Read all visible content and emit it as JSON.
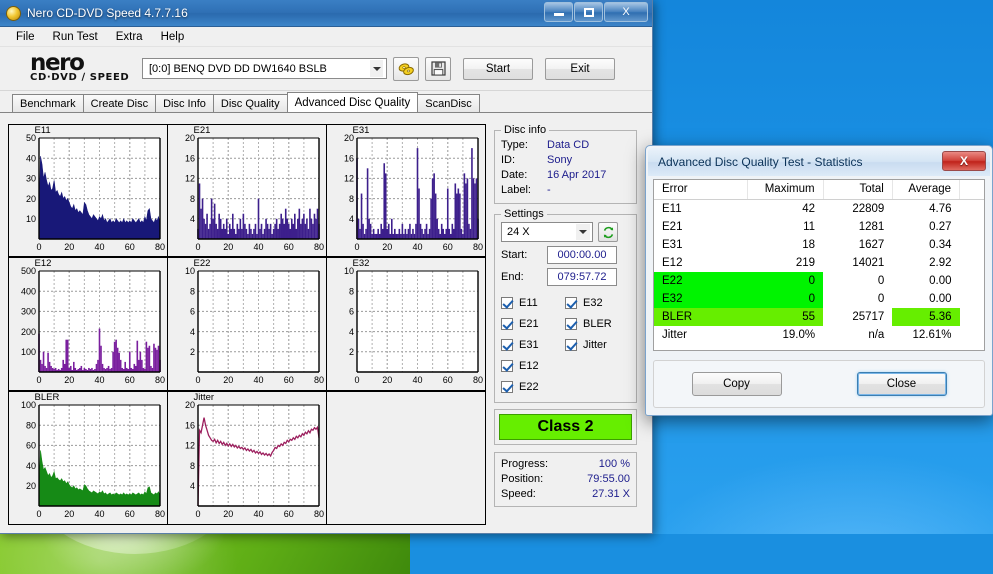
{
  "window": {
    "title": "Nero CD-DVD Speed 4.7.7.16",
    "icon": "nero-disc-icon",
    "buttons": {
      "minimize": "minimize-icon",
      "maximize": "maximize-icon",
      "close": "X"
    }
  },
  "menu": {
    "items": [
      "File",
      "Run Test",
      "Extra",
      "Help"
    ]
  },
  "toolbar": {
    "logo_main": "nero",
    "logo_sub": "CD·DVD ∕ SPEED",
    "drive": "[0:0]   BENQ DVD DD DW1640 BSLB",
    "eject_icon": "eject-disc-icon",
    "save_icon": "floppy-save-icon",
    "start_label": "Start",
    "exit_label": "Exit"
  },
  "tabs": [
    {
      "label": "Benchmark",
      "active": false
    },
    {
      "label": "Create Disc",
      "active": false
    },
    {
      "label": "Disc Info",
      "active": false
    },
    {
      "label": "Disc Quality",
      "active": false
    },
    {
      "label": "Advanced Disc Quality",
      "active": true
    },
    {
      "label": "ScanDisc",
      "active": false
    }
  ],
  "disc_info": {
    "legend": "Disc info",
    "rows": [
      {
        "key": "Type:",
        "value": "Data CD"
      },
      {
        "key": "ID:",
        "value": "Sony"
      },
      {
        "key": "Date:",
        "value": "16 Apr 2017"
      },
      {
        "key": "Label:",
        "value": "-"
      }
    ]
  },
  "settings": {
    "legend": "Settings",
    "speed": "24 X",
    "refresh_icon": "refresh-icon",
    "start_label": "Start:",
    "start_value": "000:00.00",
    "end_label": "End:",
    "end_value": "079:57.72",
    "checkboxes_left": [
      "E11",
      "E21",
      "E31",
      "E12",
      "E22"
    ],
    "checkboxes_right": [
      "E32",
      "BLER",
      "Jitter"
    ]
  },
  "class_result": "Class 2",
  "status": {
    "rows": [
      {
        "key": "Progress:",
        "value": "100 %"
      },
      {
        "key": "Position:",
        "value": "79:55.00"
      },
      {
        "key": "Speed:",
        "value": "27.31 X"
      }
    ]
  },
  "dialog": {
    "title": "Advanced Disc Quality Test - Statistics",
    "close_glyph": "X",
    "columns": [
      "Error",
      "Maximum",
      "Total",
      "Average"
    ],
    "rows": [
      {
        "error": "E11",
        "maximum": "42",
        "total": "22809",
        "average": "4.76",
        "highlight": "none"
      },
      {
        "error": "E21",
        "maximum": "11",
        "total": "1281",
        "average": "0.27",
        "highlight": "none"
      },
      {
        "error": "E31",
        "maximum": "18",
        "total": "1627",
        "average": "0.34",
        "highlight": "none"
      },
      {
        "error": "E12",
        "maximum": "219",
        "total": "14021",
        "average": "2.92",
        "highlight": "none"
      },
      {
        "error": "E22",
        "maximum": "0",
        "total": "0",
        "average": "0.00",
        "highlight": "green-bright"
      },
      {
        "error": "E32",
        "maximum": "0",
        "total": "0",
        "average": "0.00",
        "highlight": "green-bright"
      },
      {
        "error": "BLER",
        "maximum": "55",
        "total": "25717",
        "average": "5.36",
        "highlight": "green-lime-plus-avg"
      },
      {
        "error": "Jitter",
        "maximum": "19.0%",
        "total": "n/a",
        "average": "12.61%",
        "highlight": "none"
      }
    ],
    "copy_label": "Copy",
    "close_label": "Close"
  },
  "colors": {
    "titlebar_blue": "#2f70b5",
    "value_blue": "#1c1c8c",
    "green_bright": "#00f400",
    "green_lime": "#66ee00",
    "e11_navy": "#181878",
    "e12_purple": "#7a1f9e",
    "bler_green": "#168a16",
    "jitter_magenta": "#9c1f5e"
  },
  "chart_data": [
    {
      "type": "area",
      "name": "E11",
      "title": "E11",
      "xlabel": "",
      "ylabel": "",
      "xlim": [
        0,
        80
      ],
      "ylim": [
        0,
        50
      ],
      "xticks": [
        0,
        20,
        40,
        60,
        80
      ],
      "yticks": [
        10,
        20,
        30,
        40,
        50
      ],
      "grid": true,
      "color": "#181878",
      "x": [
        0,
        1,
        2,
        3,
        4,
        5,
        6,
        7,
        8,
        9,
        10,
        11,
        12,
        13,
        14,
        15,
        16,
        17,
        18,
        19,
        20,
        21,
        22,
        23,
        24,
        25,
        26,
        27,
        28,
        29,
        30,
        31,
        32,
        33,
        34,
        35,
        36,
        37,
        38,
        39,
        40,
        41,
        42,
        43,
        44,
        45,
        46,
        47,
        48,
        49,
        50,
        51,
        52,
        53,
        54,
        55,
        56,
        57,
        58,
        59,
        60,
        61,
        62,
        63,
        64,
        65,
        66,
        67,
        68,
        69,
        70,
        71,
        72,
        73,
        74,
        75,
        76,
        77,
        78,
        79,
        80
      ],
      "values": [
        12,
        41,
        37,
        30,
        33,
        29,
        26,
        28,
        24,
        25,
        29,
        23,
        24,
        22,
        21,
        23,
        20,
        21,
        19,
        20,
        18,
        16,
        15,
        17,
        14,
        15,
        13,
        14,
        13,
        12,
        18,
        17,
        14,
        12,
        11,
        10,
        12,
        11,
        10,
        9,
        11,
        10,
        12,
        9,
        10,
        8,
        9,
        10,
        8,
        9,
        8,
        10,
        9,
        8,
        9,
        8,
        10,
        8,
        9,
        8,
        9,
        8,
        10,
        9,
        8,
        9,
        10,
        8,
        9,
        8,
        11,
        9,
        14,
        15,
        10,
        9,
        8,
        10,
        9,
        11,
        8
      ]
    },
    {
      "type": "bar",
      "name": "E21",
      "title": "E21",
      "xlabel": "",
      "ylabel": "",
      "xlim": [
        0,
        80
      ],
      "ylim": [
        0,
        20
      ],
      "xticks": [
        0,
        20,
        40,
        60,
        80
      ],
      "yticks": [
        4,
        8,
        12,
        16,
        20
      ],
      "grid": true,
      "color": "#3d1f8c",
      "values": [
        2,
        11,
        6,
        8,
        4,
        3,
        5,
        2,
        3,
        8,
        4,
        7,
        3,
        2,
        5,
        4,
        2,
        3,
        2,
        4,
        1,
        3,
        2,
        5,
        2,
        1,
        3,
        2,
        4,
        2,
        5,
        3,
        2,
        1,
        3,
        2,
        1,
        2,
        3,
        1,
        8,
        2,
        3,
        1,
        2,
        4,
        3,
        2,
        3,
        1,
        2,
        3,
        4,
        2,
        3,
        5,
        4,
        3,
        6,
        4,
        3,
        2,
        4,
        3,
        5,
        2,
        4,
        6,
        3,
        4,
        5,
        3,
        4,
        2,
        6,
        4,
        3,
        5,
        4,
        6,
        3
      ]
    },
    {
      "type": "bar",
      "name": "E31",
      "title": "E31",
      "xlabel": "",
      "ylabel": "",
      "xlim": [
        0,
        80
      ],
      "ylim": [
        0,
        20
      ],
      "xticks": [
        0,
        20,
        40,
        60,
        80
      ],
      "yticks": [
        4,
        8,
        12,
        16,
        20
      ],
      "grid": true,
      "color": "#3d1f8c",
      "values": [
        16,
        4,
        2,
        9,
        3,
        1,
        2,
        14,
        4,
        3,
        1,
        2,
        1,
        1,
        2,
        1,
        3,
        2,
        15,
        13,
        2,
        3,
        1,
        4,
        1,
        2,
        1,
        1,
        2,
        1,
        3,
        1,
        2,
        1,
        2,
        3,
        1,
        2,
        1,
        3,
        18,
        10,
        3,
        2,
        1,
        2,
        3,
        1,
        2,
        8,
        12,
        13,
        9,
        4,
        2,
        1,
        3,
        2,
        1,
        2,
        10,
        2,
        1,
        3,
        2,
        11,
        9,
        10,
        9,
        2,
        1,
        13,
        11,
        12,
        3,
        2,
        18,
        12,
        11,
        12,
        4
      ]
    },
    {
      "type": "bar",
      "name": "E12",
      "title": "E12",
      "xlabel": "",
      "ylabel": "",
      "xlim": [
        0,
        80
      ],
      "ylim": [
        0,
        500
      ],
      "xticks": [
        0,
        20,
        40,
        60,
        80
      ],
      "yticks": [
        100,
        200,
        300,
        400,
        500
      ],
      "grid": true,
      "color": "#7a1f9e",
      "values": [
        190,
        60,
        40,
        100,
        30,
        20,
        95,
        50,
        30,
        20,
        15,
        20,
        10,
        15,
        10,
        20,
        60,
        40,
        160,
        160,
        20,
        30,
        10,
        50,
        20,
        10,
        15,
        20,
        30,
        10,
        20,
        15,
        10,
        20,
        15,
        20,
        10,
        15,
        40,
        60,
        215,
        130,
        40,
        20,
        15,
        20,
        30,
        15,
        20,
        100,
        150,
        160,
        120,
        95,
        60,
        20,
        15,
        50,
        20,
        15,
        100,
        20,
        15,
        40,
        30,
        155,
        60,
        100,
        60,
        20,
        15,
        150,
        120,
        130,
        30,
        20,
        140,
        120,
        110,
        130,
        60
      ]
    },
    {
      "type": "bar",
      "name": "E22",
      "title": "E22",
      "xlabel": "",
      "ylabel": "",
      "xlim": [
        0,
        80
      ],
      "ylim": [
        0,
        10
      ],
      "xticks": [
        0,
        20,
        40,
        60,
        80
      ],
      "yticks": [
        2,
        4,
        6,
        8,
        10
      ],
      "grid": true,
      "color": "#3d1f8c",
      "values": []
    },
    {
      "type": "bar",
      "name": "E32",
      "title": "E32",
      "xlabel": "",
      "ylabel": "",
      "xlim": [
        0,
        80
      ],
      "ylim": [
        0,
        10
      ],
      "xticks": [
        0,
        20,
        40,
        60,
        80
      ],
      "yticks": [
        2,
        4,
        6,
        8,
        10
      ],
      "grid": true,
      "color": "#3d1f8c",
      "values": []
    },
    {
      "type": "area",
      "name": "BLER",
      "title": "BLER",
      "xlabel": "",
      "ylabel": "",
      "xlim": [
        0,
        80
      ],
      "ylim": [
        0,
        100
      ],
      "xticks": [
        0,
        20,
        40,
        60,
        80
      ],
      "yticks": [
        20,
        40,
        60,
        80,
        100
      ],
      "grid": true,
      "color": "#168a16",
      "values": [
        20,
        55,
        44,
        36,
        38,
        34,
        30,
        32,
        28,
        30,
        34,
        27,
        28,
        26,
        25,
        27,
        24,
        25,
        22,
        24,
        21,
        19,
        18,
        20,
        17,
        18,
        16,
        17,
        16,
        15,
        21,
        20,
        17,
        15,
        14,
        13,
        15,
        14,
        13,
        12,
        14,
        13,
        15,
        12,
        13,
        11,
        12,
        13,
        11,
        12,
        11,
        13,
        12,
        11,
        12,
        11,
        13,
        11,
        12,
        11,
        12,
        11,
        13,
        12,
        11,
        12,
        13,
        11,
        12,
        11,
        14,
        12,
        18,
        19,
        13,
        12,
        11,
        13,
        12,
        14,
        11
      ]
    },
    {
      "type": "line",
      "name": "Jitter",
      "title": "Jitter",
      "xlabel": "",
      "ylabel": "",
      "xlim": [
        0,
        80
      ],
      "ylim": [
        0,
        20
      ],
      "xticks": [
        0,
        20,
        40,
        60,
        80
      ],
      "yticks": [
        4,
        8,
        12,
        16,
        20
      ],
      "grid": true,
      "color": "#9c1f5e",
      "values": [
        0,
        15,
        14.5,
        16,
        17.5,
        16,
        15,
        14,
        13.5,
        13,
        12.8,
        13.2,
        12.5,
        13,
        12.4,
        12.8,
        12.2,
        12.6,
        12,
        12.4,
        11.9,
        12.3,
        11.8,
        12.2,
        11.7,
        12,
        11.5,
        11.8,
        11.4,
        11.6,
        11.2,
        11.5,
        11,
        11.3,
        10.9,
        11.2,
        10.7,
        11,
        10.5,
        10.8,
        10.4,
        10.7,
        10.2,
        10.5,
        10.1,
        10.4,
        10,
        10.3,
        9.9,
        10.6,
        11,
        11.6,
        11.4,
        12,
        11.8,
        12.3,
        12,
        12.6,
        12.4,
        13,
        12.7,
        13.2,
        13,
        13.5,
        13.2,
        13.8,
        13.5,
        14,
        13.7,
        14.3,
        14,
        14.6,
        14.3,
        14.9,
        14.5,
        15.2,
        15,
        15.5,
        15.2,
        15.6,
        13.5
      ]
    }
  ]
}
